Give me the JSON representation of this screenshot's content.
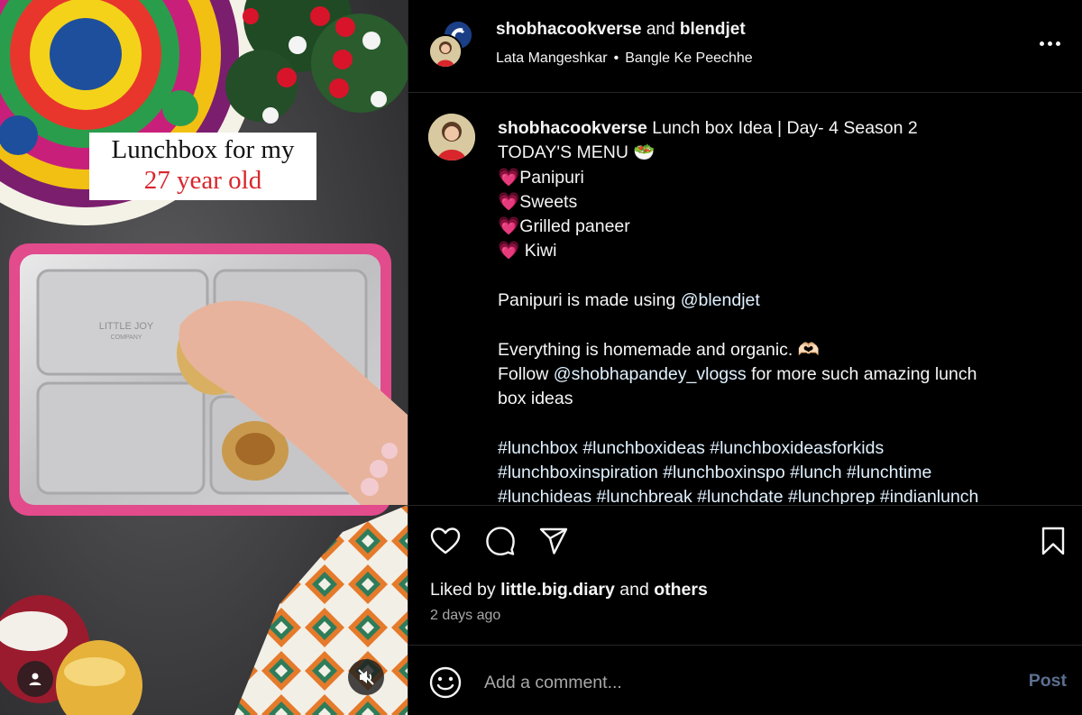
{
  "media": {
    "overlay_line1": "Lunchbox for my",
    "overlay_line2": "27 year old",
    "overlay_line2_color": "#d8262c",
    "tray_brand": "LITTLE JOY",
    "tray_brand_sub": "COMPANY",
    "user_tag_icon": "user-icon",
    "mute_icon": "speaker-muted-icon"
  },
  "header": {
    "author": "shobhacookverse",
    "and_text": "and",
    "collaborator": "blendjet",
    "audio_artist": "Lata Mangeshkar",
    "audio_separator": "•",
    "audio_track": "Bangle Ke Peechhe",
    "more_icon": "more-horizontal-icon"
  },
  "caption": {
    "username": "shobhacookverse",
    "lines": [
      "Lunch box Idea | Day- 4 Season 2",
      "TODAY'S MENU 🥗",
      "💗Panipuri",
      "💗Sweets",
      "💗Grilled paneer",
      "💗 Kiwi",
      "",
      "Panipuri is made using ",
      "",
      "Everything is homemade and organic. 🫶🏻",
      "Follow ",
      "box ideas",
      "",
      "#lunchbox #lunchboxideas #lunchboxideasforkids",
      "#lunchboxinspiration #lunchboxinspo #lunch #lunchtime",
      "#lunchideas #lunchbreak #lunchdate #lunchprep #indianlunch"
    ],
    "mention_blendjet": "@blendjet",
    "mention_vlogs": "@shobhapandey_vlogss",
    "follow_tail": " for more such amazing lunch"
  },
  "actions": {
    "like_icon": "heart-icon",
    "comment_icon": "comment-icon",
    "share_icon": "send-icon",
    "save_icon": "bookmark-icon"
  },
  "likes": {
    "prefix": "Liked by",
    "user": "little.big.diary",
    "and_text": "and",
    "others": "others"
  },
  "timestamp": "2 days ago",
  "comment": {
    "placeholder": "Add a comment...",
    "post_label": "Post",
    "emoji_icon": "smiley-icon"
  },
  "colors": {
    "background": "#000000",
    "text": "#f5f5f5",
    "muted": "#a8a8a8",
    "link": "#e0f1ff",
    "post_disabled": "#5b6f8f",
    "divider": "#262626"
  }
}
